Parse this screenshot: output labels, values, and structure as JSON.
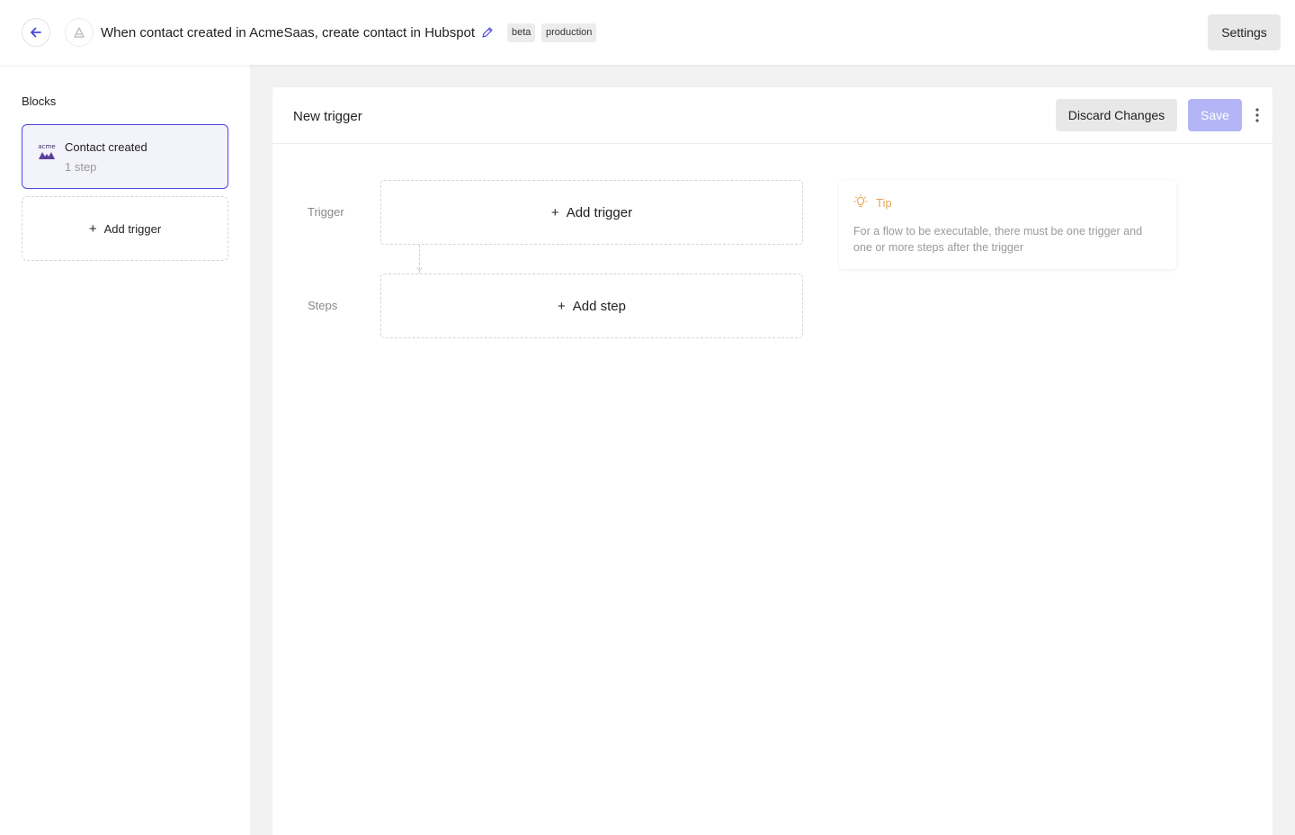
{
  "header": {
    "back_icon": "arrow-left-icon",
    "app_icon": "app-logo-icon",
    "flow_title": "When contact created in AcmeSaas, create contact in Hubspot",
    "edit_icon": "pencil-icon",
    "tags": [
      "beta",
      "production"
    ],
    "settings_label": "Settings"
  },
  "sidebar": {
    "heading": "Blocks",
    "blocks": [
      {
        "logo_text": "acme",
        "title": "Contact created",
        "subtitle": "1 step"
      }
    ],
    "add_trigger_label": "Add trigger"
  },
  "editor": {
    "title": "New trigger",
    "discard_label": "Discard Changes",
    "save_label": "Save",
    "trigger_label": "Trigger",
    "add_trigger_label": "Add trigger",
    "steps_label": "Steps",
    "add_step_label": "Add step"
  },
  "tip": {
    "icon": "lightbulb-icon",
    "title": "Tip",
    "text": "For a flow to be executable, there must be one trigger and one or more steps after the trigger"
  },
  "colors": {
    "accent": "#4f46e5",
    "save_disabled": "#b3b5f6",
    "tip": "#e8a352"
  }
}
